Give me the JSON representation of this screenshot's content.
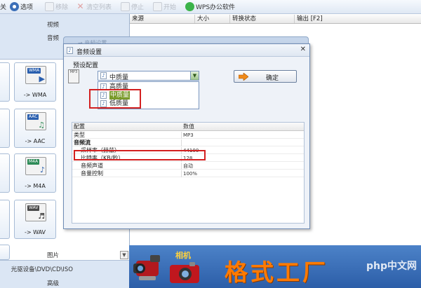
{
  "toolbar": {
    "items": [
      {
        "label": "关",
        "faded": false
      },
      {
        "label": "选项",
        "faded": false
      },
      {
        "label": "移除",
        "faded": true
      },
      {
        "label": "清空列表",
        "faded": true
      },
      {
        "label": "停止",
        "faded": true
      },
      {
        "label": "开始",
        "faded": true
      },
      {
        "label": "WPS办公软件",
        "faded": false
      }
    ]
  },
  "left_panel": {
    "categories_top": [
      "视频",
      "音频"
    ],
    "formats": [
      {
        "label": "-> WMA",
        "tag": "WMA",
        "tag_color": "#2a5fae",
        "glyph": "▶"
      },
      {
        "label": "-> AAC",
        "tag": "AAC",
        "tag_color": "#2a5fae",
        "glyph": "♫"
      },
      {
        "label": "-> M4A",
        "tag": "M4A",
        "tag_color": "#2e8b57",
        "glyph": "♪"
      },
      {
        "label": "-> WAV",
        "tag": "WAV",
        "tag_color": "#4a4a4a",
        "glyph": "♬"
      }
    ],
    "categories_bottom": [
      "图片",
      "光驱设备\\DVD\\CD\\ISO",
      "高级"
    ]
  },
  "file_list": {
    "columns": [
      "来源",
      "大小",
      "转换状态",
      "输出 [F2]"
    ]
  },
  "bottom_bar": {
    "camera_label": "相机",
    "brand": "格式工厂",
    "watermark": "php中文网"
  },
  "background_window": {
    "title": "→ 音频设置"
  },
  "dialog": {
    "title": "音频设置",
    "preset_label": "预设配置",
    "preset_selected": "中质量",
    "mp3_badge": "MP3",
    "dropdown_options": [
      "高质量",
      "中质量",
      "低质量"
    ],
    "dropdown_highlighted": "中质量",
    "ok_label": "确定",
    "grid_headers": {
      "key": "配置",
      "value": "数值"
    },
    "grid_rows": [
      {
        "key": "类型",
        "value": "MP3",
        "indent": false,
        "group": false
      },
      {
        "key": "音频流",
        "value": "",
        "indent": false,
        "group": true
      },
      {
        "key": "采样率（赫兹）",
        "value": "44100",
        "indent": true,
        "group": false
      },
      {
        "key": "比特率（KB/秒）",
        "value": "128",
        "indent": true,
        "group": false
      },
      {
        "key": "音频声道",
        "value": "自动",
        "indent": true,
        "group": false
      },
      {
        "key": "音量控制",
        "value": "100%",
        "indent": true,
        "group": false
      }
    ]
  },
  "colors": {
    "highlight_box": "#d32020",
    "selection": "#7a9a2a",
    "brand_orange": "#ff7a00"
  }
}
